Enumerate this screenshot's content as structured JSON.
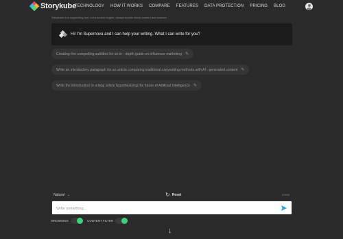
{
  "header": {
    "logo_text": "Storykube",
    "nav": [
      "TECHNOLOGY",
      "HOW IT WORKS",
      "COMPARE",
      "FEATURES",
      "DATA PROTECTION",
      "PRICING",
      "BLOG"
    ],
    "avatar_icon": "user-avatar-icon"
  },
  "tagline": "Storykube is a copywriting tool, not a search engine, always double check content and sources.",
  "welcome": {
    "text": "Hi! I'm Supernova and I can help your writing. What I can write for you?",
    "icon": "bot-icon"
  },
  "suggestions": [
    "Creating five compelling subtitles for an in - depth guide on influencer marketing",
    "Write an introductory paragraph for an article comparing traditional copywriting methods with AI - generated content",
    "Write the introduction to a blog article hypothesizing the future of Artificial Intelligence"
  ],
  "composer": {
    "tone": "Natural",
    "reset_label": "Reset",
    "counter": "0/2000",
    "placeholder": "Write something...",
    "send_icon": "send-icon"
  },
  "toggles": {
    "browsing_label": "BROWSING",
    "browsing_on": true,
    "content_filter_label": "CONTENT FILTER",
    "content_filter_on": true
  },
  "scroll_down_icon": "arrow-down-icon",
  "colors": {
    "background": "#2a2a2a",
    "panel": "#1b1b1b",
    "chip": "#353535",
    "toggle_on": "#3ecf7a",
    "send": "#29a3e0"
  }
}
